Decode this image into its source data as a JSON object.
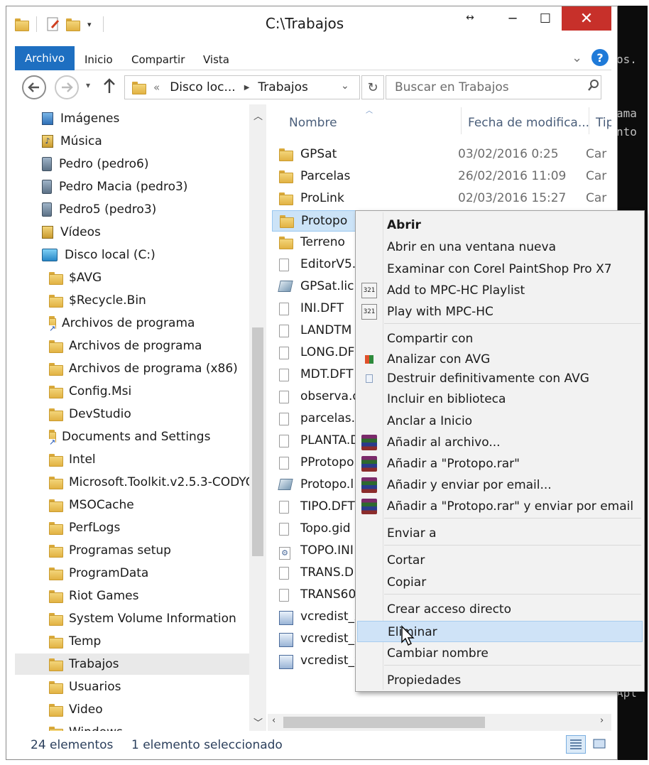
{
  "window": {
    "title": "C:\\Trabajos"
  },
  "terminal": {
    "lines": [
      "os.",
      "ama",
      "nto",
      "Apl"
    ]
  },
  "ribbon": {
    "file_tab": "Archivo",
    "tabs": [
      "Inicio",
      "Compartir",
      "Vista"
    ]
  },
  "address": {
    "overflow": "«",
    "segments": [
      "Disco loc...",
      "Trabajos"
    ]
  },
  "search": {
    "placeholder": "Buscar en Trabajos"
  },
  "nav": {
    "items": [
      {
        "label": "Imágenes",
        "icon": "pictures-icon",
        "level": 1
      },
      {
        "label": "Música",
        "icon": "music-icon",
        "level": 1
      },
      {
        "label": "Pedro (pedro6)",
        "icon": "network-drive-icon",
        "level": 1
      },
      {
        "label": "Pedro Macia (pedro3)",
        "icon": "network-drive-icon",
        "level": 1
      },
      {
        "label": "Pedro5 (pedro3)",
        "icon": "network-drive-icon",
        "level": 1
      },
      {
        "label": "Vídeos",
        "icon": "videos-icon",
        "level": 1
      },
      {
        "label": "Disco local (C:)",
        "icon": "local-disk-icon",
        "level": 1
      },
      {
        "label": "$AVG",
        "icon": "folder-icon",
        "level": 2
      },
      {
        "label": "$Recycle.Bin",
        "icon": "folder-icon",
        "level": 2
      },
      {
        "label": "Archivos de programa",
        "icon": "shortcut-folder-icon",
        "level": 2
      },
      {
        "label": "Archivos de programa",
        "icon": "folder-icon",
        "level": 2
      },
      {
        "label": "Archivos de programa (x86)",
        "icon": "folder-icon",
        "level": 2
      },
      {
        "label": "Config.Msi",
        "icon": "folder-icon",
        "level": 2
      },
      {
        "label": "DevStudio",
        "icon": "folder-icon",
        "level": 2
      },
      {
        "label": "Documents and Settings",
        "icon": "shortcut-folder-icon",
        "level": 2
      },
      {
        "label": "Intel",
        "icon": "folder-icon",
        "level": 2
      },
      {
        "label": "Microsoft.Toolkit.v2.5.3-CODYO",
        "icon": "folder-icon",
        "level": 2
      },
      {
        "label": "MSOCache",
        "icon": "folder-icon",
        "level": 2
      },
      {
        "label": "PerfLogs",
        "icon": "folder-icon",
        "level": 2
      },
      {
        "label": "Programas setup",
        "icon": "folder-icon",
        "level": 2
      },
      {
        "label": "ProgramData",
        "icon": "folder-icon",
        "level": 2
      },
      {
        "label": "Riot Games",
        "icon": "folder-icon",
        "level": 2
      },
      {
        "label": "System Volume Information",
        "icon": "folder-icon",
        "level": 2
      },
      {
        "label": "Temp",
        "icon": "folder-icon",
        "level": 2
      },
      {
        "label": "Trabajos",
        "icon": "folder-icon",
        "level": 2,
        "selected": true
      },
      {
        "label": "Usuarios",
        "icon": "folder-icon",
        "level": 2
      },
      {
        "label": "Video",
        "icon": "folder-icon",
        "level": 2
      },
      {
        "label": "Windows",
        "icon": "folder-icon",
        "level": 2
      }
    ]
  },
  "files": {
    "columns": [
      "Nombre",
      "Fecha de modifica...",
      "Tipo"
    ],
    "rows": [
      {
        "name": "GPSat",
        "date": "03/02/2016 0:25",
        "type": "Car",
        "icon": "folder-icon"
      },
      {
        "name": "Parcelas",
        "date": "26/02/2016 11:09",
        "type": "Car",
        "icon": "folder-icon"
      },
      {
        "name": "ProLink",
        "date": "02/03/2016 15:27",
        "type": "Car",
        "icon": "folder-icon"
      },
      {
        "name": "Protopo",
        "date": "",
        "type": "",
        "icon": "folder-icon",
        "selected": true
      },
      {
        "name": "Terreno",
        "date": "",
        "type": "",
        "icon": "folder-icon"
      },
      {
        "name": "EditorV5.",
        "date": "",
        "type": "",
        "icon": "file-icon"
      },
      {
        "name": "GPSat.lic",
        "date": "",
        "type": "",
        "icon": "license-file-icon"
      },
      {
        "name": "INI.DFT",
        "date": "",
        "type": "",
        "icon": "file-icon"
      },
      {
        "name": "LANDTM",
        "date": "",
        "type": "",
        "icon": "file-icon"
      },
      {
        "name": "LONG.DF",
        "date": "",
        "type": "",
        "icon": "file-icon"
      },
      {
        "name": "MDT.DFT",
        "date": "",
        "type": "",
        "icon": "file-icon"
      },
      {
        "name": "observa.d",
        "date": "",
        "type": "",
        "icon": "file-icon"
      },
      {
        "name": "parcelas.c",
        "date": "",
        "type": "",
        "icon": "file-icon"
      },
      {
        "name": "PLANTA.D",
        "date": "",
        "type": "",
        "icon": "file-icon"
      },
      {
        "name": "PProtopo",
        "date": "",
        "type": "",
        "icon": "file-icon"
      },
      {
        "name": "Protopo.l",
        "date": "",
        "type": "",
        "icon": "license-file-icon"
      },
      {
        "name": "TIPO.DFT",
        "date": "",
        "type": "",
        "icon": "file-icon"
      },
      {
        "name": "Topo.gid",
        "date": "",
        "type": "",
        "icon": "file-icon"
      },
      {
        "name": "TOPO.INI",
        "date": "",
        "type": "",
        "icon": "settings-file-icon"
      },
      {
        "name": "TRANS.D",
        "date": "",
        "type": "",
        "icon": "file-icon"
      },
      {
        "name": "TRANS60",
        "date": "",
        "type": "",
        "icon": "file-icon"
      },
      {
        "name": "vcredist_x",
        "date": "",
        "type": "",
        "icon": "installer-icon"
      },
      {
        "name": "vcredist_x",
        "date": "",
        "type": "",
        "icon": "installer-icon"
      },
      {
        "name": "vcredist_x",
        "date": "",
        "type": "",
        "icon": "installer-icon"
      }
    ]
  },
  "context_menu": {
    "groups": [
      [
        {
          "label": "Abrir",
          "bold": true
        },
        {
          "label": "Abrir en una ventana nueva"
        },
        {
          "label": "Examinar con Corel PaintShop Pro X7"
        },
        {
          "label": "Add to MPC-HC Playlist",
          "icon": "mpc-hc-icon"
        },
        {
          "label": "Play with MPC-HC",
          "icon": "mpc-hc-icon"
        }
      ],
      [
        {
          "label": "Compartir con"
        },
        {
          "label": "Analizar con AVG",
          "icon": "avg-icon"
        },
        {
          "label": "Destruir definitivamente con AVG",
          "icon": "shredder-icon"
        },
        {
          "label": "Incluir en biblioteca"
        },
        {
          "label": "Anclar a Inicio"
        },
        {
          "label": "Añadir al archivo...",
          "icon": "winrar-icon"
        },
        {
          "label": "Añadir a \"Protopo.rar\"",
          "icon": "winrar-icon"
        },
        {
          "label": "Añadir y enviar por email...",
          "icon": "winrar-icon"
        },
        {
          "label": "Añadir a \"Protopo.rar\" y enviar por email",
          "icon": "winrar-icon"
        }
      ],
      [
        {
          "label": "Enviar a"
        }
      ],
      [
        {
          "label": "Cortar"
        },
        {
          "label": "Copiar"
        }
      ],
      [
        {
          "label": "Crear acceso directo"
        },
        {
          "label": "Eliminar",
          "highlighted": true
        },
        {
          "label": "Cambiar nombre"
        }
      ],
      [
        {
          "label": "Propiedades"
        }
      ]
    ]
  },
  "status": {
    "count": "24 elementos",
    "selection": "1 elemento seleccionado"
  },
  "colors": {
    "accent": "#1e6fc1",
    "close": "#c7302a",
    "selection": "#cce3f7",
    "menu_highlight": "#cfe3f7"
  }
}
